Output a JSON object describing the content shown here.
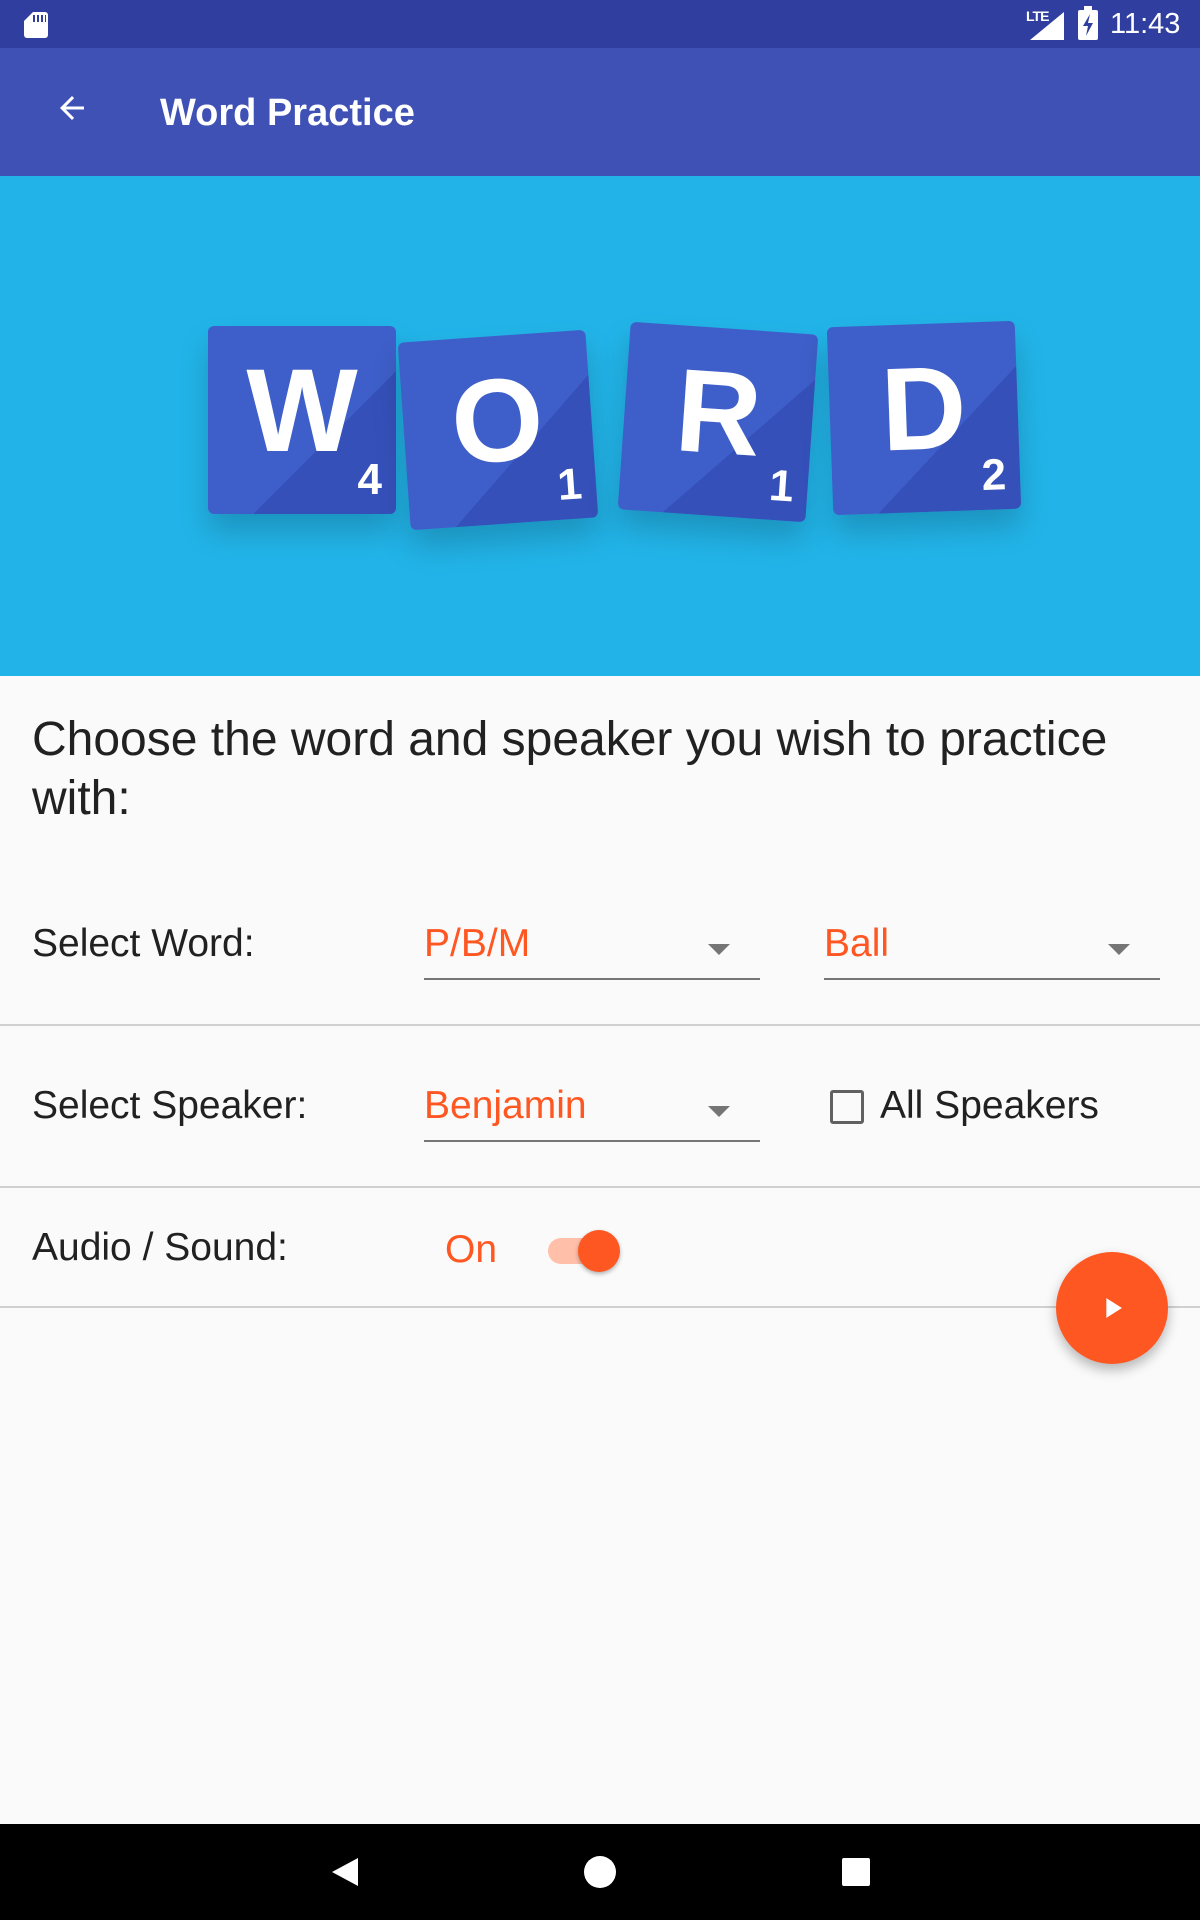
{
  "status_bar": {
    "network": "LTE",
    "time": "11:43"
  },
  "app_bar": {
    "title": "Word Practice"
  },
  "hero": {
    "tiles": [
      {
        "letter": "W",
        "score": "4"
      },
      {
        "letter": "O",
        "score": "1"
      },
      {
        "letter": "R",
        "score": "1"
      },
      {
        "letter": "D",
        "score": "2"
      }
    ]
  },
  "prompt": "Choose the word and speaker you wish to practice with:",
  "select_word": {
    "label": "Select Word:",
    "group_value": "P/B/M",
    "word_value": "Ball"
  },
  "select_speaker": {
    "label": "Select Speaker:",
    "speaker_value": "Benjamin",
    "all_speakers_label": "All Speakers",
    "all_speakers_checked": false
  },
  "audio": {
    "label": "Audio / Sound:",
    "state_text": "On",
    "enabled": true
  },
  "colors": {
    "primary": "#3f51b5",
    "primary_dark": "#303f9f",
    "accent": "#ff5722",
    "hero_bg": "#22b4e8"
  },
  "icons": [
    "sd-card-icon",
    "signal-icon",
    "battery-charging-icon",
    "arrow-back-icon",
    "play-icon",
    "nav-back-icon",
    "nav-home-icon",
    "nav-recents-icon"
  ]
}
